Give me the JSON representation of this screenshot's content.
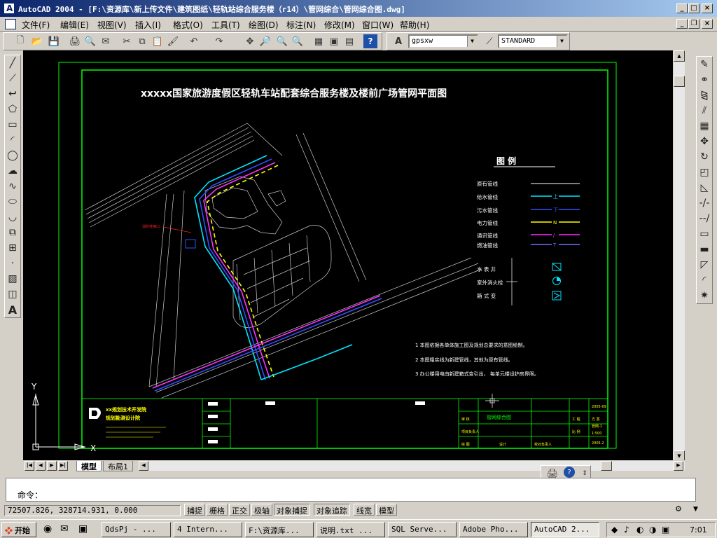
{
  "window": {
    "title": "AutoCAD 2004 - [F:\\资源库\\新上传文件\\建筑图纸\\轻轨站综合服务楼（r14）\\管网综合\\管网综合图.dwg]"
  },
  "menu": [
    "文件(F)",
    "编辑(E)",
    "视图(V)",
    "插入(I)",
    "格式(O)",
    "工具(T)",
    "绘图(D)",
    "标注(N)",
    "修改(M)",
    "窗口(W)",
    "帮助(H)"
  ],
  "toolbar": {
    "font_select": "gpsxw",
    "dimstyle_select": "STANDARD"
  },
  "drawing": {
    "title": "xxxxx国家旅游度假区轻轨车站配套综合服务楼及楼前广场管网平面图",
    "legend": {
      "header": "图        例",
      "lines": [
        {
          "label": "原有管线",
          "mark": "",
          "color": "#ffffff"
        },
        {
          "label": "给水管线",
          "mark": "上",
          "color": "#00e5ff"
        },
        {
          "label": "污水管线",
          "mark": "下",
          "color": "#3050ff"
        },
        {
          "label": "电力管线",
          "mark": "N",
          "color": "#ffff00"
        },
        {
          "label": "通讯管线",
          "mark": "/",
          "color": "#ff30ff"
        },
        {
          "label": "燃油管线",
          "mark": "T",
          "color": "#7070ff"
        }
      ],
      "symbols": [
        {
          "label": "水 表 井"
        },
        {
          "label": "室外消火栓"
        },
        {
          "label": "箱 式 变"
        }
      ]
    },
    "notes": [
      "1  本图依据各单体施工图及规划总要求的意图绘制。",
      "2  本图粗实线为新建管线，其他为原有管线。",
      "3  办公楼用电由新建箱式变引出，  每单元楼设护房界限。"
    ],
    "titleblock": {
      "company_line1": "xx规划技术开发院",
      "company_line2": "规划勘测设计院",
      "drawing_name": "管网综合图",
      "field_checker": "审 核",
      "field_scale": "比 例",
      "scale_value": "1:500",
      "drawing_no": "管网-1",
      "date_value": "2005.2",
      "year_value": "2005-09",
      "label_pm": "项目负责人",
      "label_design": "设计",
      "label_draw": "绘  图",
      "label_proj": "工 程",
      "label_proj_val": "方 案",
      "label_check": "校对负责人"
    },
    "callout": "消防栓接口"
  },
  "ucs": {
    "y": "Y",
    "x": "X"
  },
  "tabs": {
    "model": "模型",
    "layout": "布局1"
  },
  "command": {
    "prompt": "命令："
  },
  "status": {
    "coords": "72507.826, 328714.931, 0.000",
    "buttons": [
      "捕捉",
      "栅格",
      "正交",
      "极轴",
      "对象捕捉",
      "对象追踪",
      "线宽",
      "模型"
    ]
  },
  "taskbar": {
    "start": "开始",
    "tasks": [
      {
        "label": "QdsPj - ...",
        "active": false
      },
      {
        "label": "4 Intern...",
        "active": false
      },
      {
        "label": "F:\\资源库...",
        "active": false
      },
      {
        "label": "说明.txt ...",
        "active": false
      },
      {
        "label": "SQL Serve...",
        "active": false
      },
      {
        "label": "Adobe Pho...",
        "active": false
      },
      {
        "label": "AutoCAD 2...",
        "active": true
      }
    ],
    "clock": "7:01"
  },
  "colors": {
    "canvas_bg": "#000000",
    "border_green": "#00ff00",
    "title_white": "#ffffff",
    "pipe_cyan": "#00e5ff",
    "pipe_blue": "#3050ff",
    "pipe_yellow": "#ffff00",
    "pipe_magenta": "#ff30ff",
    "callout_red": "#ff2020"
  }
}
